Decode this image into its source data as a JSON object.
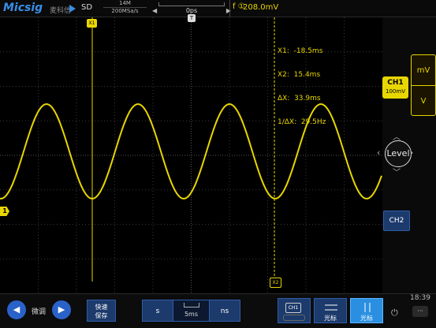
{
  "header": {
    "logo": "Micsig",
    "logo_cn": "麦科信",
    "acq_mode": "SD",
    "memory_depth": "14M",
    "sample_rate": "200MSa/s",
    "trigger_position": "0ps",
    "trigger_level_prefix": "f ①",
    "trigger_level": "208.0mV"
  },
  "cursor_readout": {
    "x1": "X1:  -18.5ms",
    "x2": "X2:  15.4ms",
    "dx": "ΔX:  33.9ms",
    "inv_dx": "1/ΔX:  29.5Hz"
  },
  "markers": {
    "x1_label": "X1",
    "x2_label": "X2",
    "ch1_marker": "1",
    "trigger_marker": "T"
  },
  "right_panel": {
    "unit_top": "mV",
    "unit_bottom": "V",
    "ch1_label": "CH1",
    "ch1_scale": "100mV",
    "level_label": "Level",
    "ch2_label": "CH2"
  },
  "bottom_bar": {
    "fine_label": "微调",
    "fast_save": "快速",
    "fast_save_2": "保存",
    "time_unit_s": "s",
    "timebase": "5ms",
    "time_unit_ns": "ns",
    "ch1_chip": "CH1",
    "cursor_label": "光标",
    "cursor_active_label": "光标",
    "clock": "18:39"
  },
  "colors": {
    "ch1": "#e8d600",
    "accent": "#2a62c9",
    "grid": "#3a3a3a"
  }
}
